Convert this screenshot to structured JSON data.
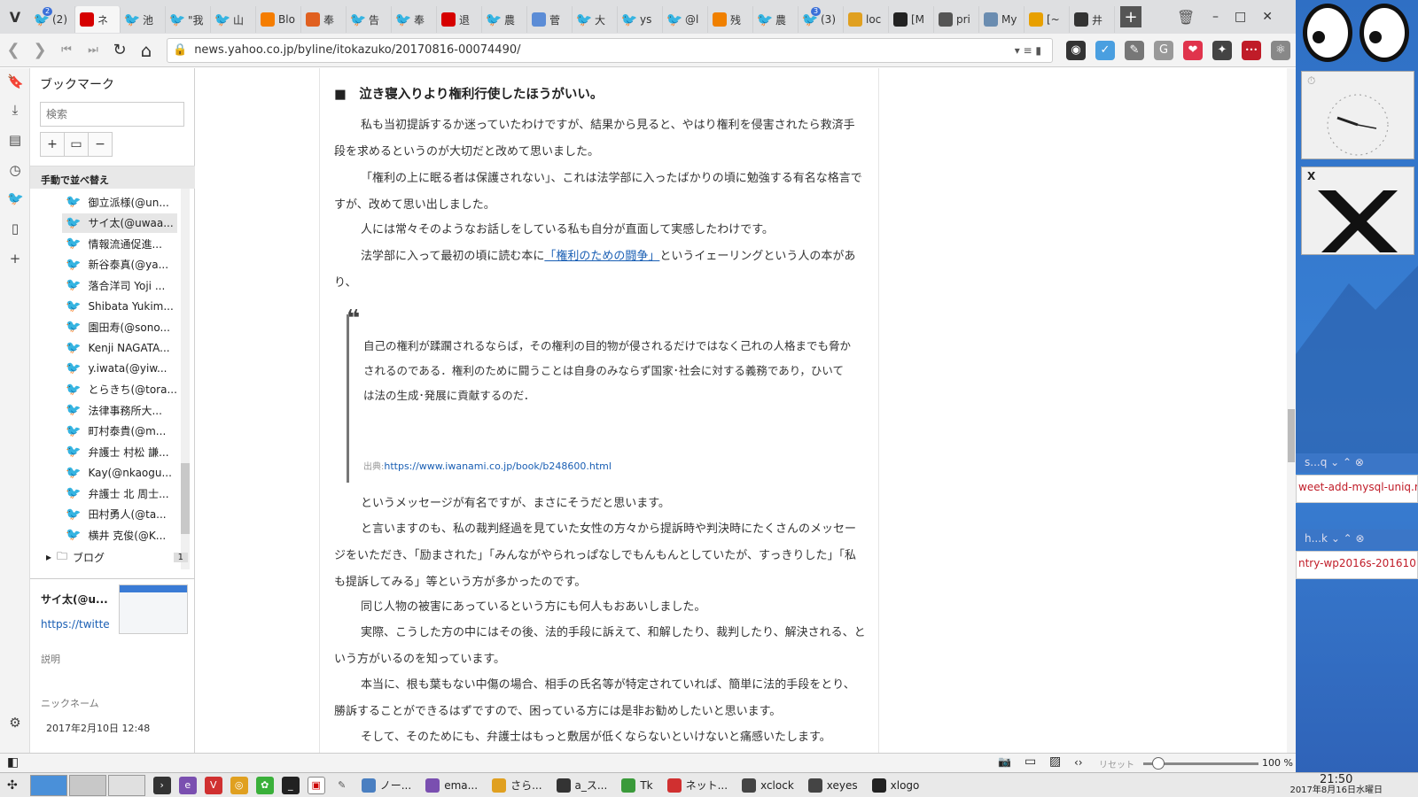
{
  "browser": {
    "menu_glyph": "V",
    "tabs": [
      {
        "label": "(2)",
        "icon": "twitter-icon",
        "badge": "2",
        "color": "#1da1f2"
      },
      {
        "label": "ネ",
        "icon": "yahoo-icon",
        "badge": "",
        "color": "#d60000",
        "active": true
      },
      {
        "label": "池",
        "icon": "twitter-icon",
        "badge": "",
        "color": "#1da1f2"
      },
      {
        "label": "\"我",
        "icon": "twitter-icon",
        "badge": "",
        "color": "#1da1f2"
      },
      {
        "label": "山",
        "icon": "twitter-icon",
        "badge": "",
        "color": "#1da1f2"
      },
      {
        "label": "Blo",
        "icon": "blogger-icon",
        "badge": "",
        "color": "#f57d00"
      },
      {
        "label": "奉",
        "icon": "fire-icon",
        "badge": "",
        "color": "#e06020"
      },
      {
        "label": "告",
        "icon": "twitter-icon",
        "badge": "",
        "color": "#1da1f2"
      },
      {
        "label": "奉",
        "icon": "twitter-icon",
        "badge": "",
        "color": "#1da1f2"
      },
      {
        "label": "退",
        "icon": "yahoo-icon",
        "badge": "",
        "color": "#d60000"
      },
      {
        "label": "農",
        "icon": "twitter-icon",
        "badge": "",
        "color": "#1da1f2"
      },
      {
        "label": "菅",
        "icon": "edit-icon",
        "badge": "",
        "color": "#5b8cd6"
      },
      {
        "label": "大",
        "icon": "twitter-icon",
        "badge": "",
        "color": "#1da1f2"
      },
      {
        "label": "ys",
        "icon": "twitter-icon",
        "badge": "",
        "color": "#1da1f2"
      },
      {
        "label": "@l",
        "icon": "twitter-icon",
        "badge": "",
        "color": "#1da1f2"
      },
      {
        "label": "残",
        "icon": "orange-icon",
        "badge": "",
        "color": "#f08000"
      },
      {
        "label": "農",
        "icon": "twitter-icon",
        "badge": "",
        "color": "#1da1f2"
      },
      {
        "label": "(3)",
        "icon": "twitter-icon",
        "badge": "3",
        "color": "#1da1f2"
      },
      {
        "label": "loc",
        "icon": "pma-icon",
        "badge": "",
        "color": "#e0a020"
      },
      {
        "label": "[M",
        "icon": "github-icon",
        "badge": "",
        "color": "#222"
      },
      {
        "label": "pri",
        "icon": "circle-icon",
        "badge": "",
        "color": "#555"
      },
      {
        "label": "My",
        "icon": "search-icon",
        "badge": "",
        "color": "#6a8cb0"
      },
      {
        "label": "[~",
        "icon": "r-icon",
        "badge": "",
        "color": "#e8a000"
      },
      {
        "label": "井",
        "icon": "wikipedia-icon",
        "badge": "",
        "color": "#333"
      }
    ],
    "new_tab": "+",
    "trash": "🗑",
    "window_controls": {
      "minimize": "–",
      "maximize": "□",
      "close": "✕"
    },
    "nav": {
      "back": "❮",
      "forward": "❯",
      "first": "⏮",
      "last": "⏭",
      "reload": "↻",
      "home": "⌂"
    },
    "url": "news.yahoo.co.jp/byline/itokazuko/20170816-00074490/",
    "url_right": "▾  ≡  ▮",
    "extensions": [
      {
        "name": "owl-icon",
        "glyph": "◉",
        "color": "#333"
      },
      {
        "name": "v-icon",
        "glyph": "✓",
        "color": "#4a9fe0"
      },
      {
        "name": "tool-icon",
        "glyph": "✎",
        "color": "#777"
      },
      {
        "name": "g-icon",
        "glyph": "G",
        "color": "#999"
      },
      {
        "name": "pocket-icon",
        "glyph": "❤",
        "color": "#e0344c"
      },
      {
        "name": "evernote-icon",
        "glyph": "✦",
        "color": "#444"
      },
      {
        "name": "dots-icon",
        "glyph": "•••",
        "color": "#c01c28"
      },
      {
        "name": "atom-icon",
        "glyph": "⚛",
        "color": "#888"
      }
    ]
  },
  "sidebar": {
    "title": "ブックマーク",
    "search_placeholder": "検索",
    "tools": [
      "+",
      "▭",
      "−"
    ],
    "sort_label": "手動で並べ替え",
    "items": [
      "御立派様(@un...",
      "サイ太(@uwaa...",
      "情報流通促進...",
      "新谷泰真(@ya...",
      "落合洋司 Yoji ...",
      "Shibata Yukim...",
      "園田寿(@sono...",
      "Kenji NAGATA...",
      "y.iwata(@yiw...",
      "とらきち(@tora...",
      "法律事務所大...",
      "町村泰貴(@m...",
      "弁護士 村松 謙...",
      "Kay(@nkaogu...",
      "弁護士 北 周士...",
      "田村勇人(@ta...",
      "横井 克俊(@K..."
    ],
    "folder": {
      "label": "ブログ",
      "count": "1"
    },
    "detail": {
      "name": "サイ太(@u...",
      "link": "https://twitte",
      "desc_label": "説明",
      "nick_label": "ニックネーム",
      "date": "2017年2月10日 12:48"
    }
  },
  "article": {
    "heading": "泣き寝入りより権利行使したほうがいい。",
    "p1": "私も当初提訴するか迷っていたわけですが、結果から見ると、やはり権利を侵害されたら救済手段を求めるというのが大切だと改めて思いました。",
    "p2": "「権利の上に眠る者は保護されない」、これは法学部に入ったばかりの頃に勉強する有名な格言ですが、改めて思い出しました。",
    "p3": "人には常々そのようなお話しをしている私も自分が直面して実感したわけです。",
    "p4_pre": "法学部に入って最初の頃に読む本に",
    "p4_link": "「権利のための闘争」",
    "p4_post": "というイェーリングという人の本があり、",
    "quote": "自己の権利が蹂躙されるならば，その権利の目的物が侵されるだけではなく己れの人格までも脅かされるのである．権利のために闘うことは自身のみならず国家･社会に対する義務であり，ひいては法の生成･発展に貢献するのだ．",
    "quote_src_label": "出典:",
    "quote_src_url": "https://www.iwanami.co.jp/book/b248600.html",
    "p5": "というメッセージが有名ですが、まさにそうだと思います。",
    "p6": "と言いますのも、私の裁判経過を見ていた女性の方々から提訴時や判決時にたくさんのメッセージをいただき、「励まされた」「みんながやられっぱなしでもんもんとしていたが、すっきりした」「私も提訴してみる」等という方が多かったのです。",
    "p7": "同じ人物の被害にあっているという方にも何人もおあいしました。",
    "p8": "実際、こうした方の中にはその後、法的手段に訴えて、和解したり、裁判したり、解決される、という方がいるのを知っています。",
    "p9": "本当に、根も葉もない中傷の場合、相手の氏名等が特定されていれば、簡単に法的手段をとり、勝訴することができるはずですので、困っている方には是非お勧めしたいと思います。",
    "p10": "そして、そのためにも、弁護士はもっと敷居が低くならないといけないと痛感いたします。"
  },
  "statusbar": {
    "reset_label": "リセット",
    "zoom": "100 %",
    "zoom_fraction": 0.13
  },
  "desktop": {
    "widget1_title": "⏱",
    "widget2_title": "X",
    "notif1_title": "s...q",
    "notif1_text": "weet-add-mysql-uniq.rb",
    "notif2_title": "h...k",
    "notif2_text": "ntry-wp2016s-201610"
  },
  "taskbar": {
    "tasks": [
      {
        "label": "ノー...",
        "icon": "folder-icon",
        "color": "#4a7fc1"
      },
      {
        "label": "ema...",
        "icon": "emacs-icon",
        "color": "#7a4fb0"
      },
      {
        "label": "さら...",
        "icon": "chrome-icon",
        "color": "#e0a020"
      },
      {
        "label": "a_ス...",
        "icon": "terminal-icon",
        "color": "#333"
      },
      {
        "label": "Tk",
        "icon": "tk-icon",
        "color": "#3a9a3a"
      },
      {
        "label": "ネット...",
        "icon": "vivaldi-icon",
        "color": "#d03030"
      },
      {
        "label": "xclock",
        "icon": "clock-icon",
        "color": "#444"
      },
      {
        "label": "xeyes",
        "icon": "eyes-icon",
        "color": "#444"
      },
      {
        "label": "xlogo",
        "icon": "x-icon",
        "color": "#222"
      }
    ],
    "time": "21:50",
    "date": "2017年8月16日水曜日"
  }
}
